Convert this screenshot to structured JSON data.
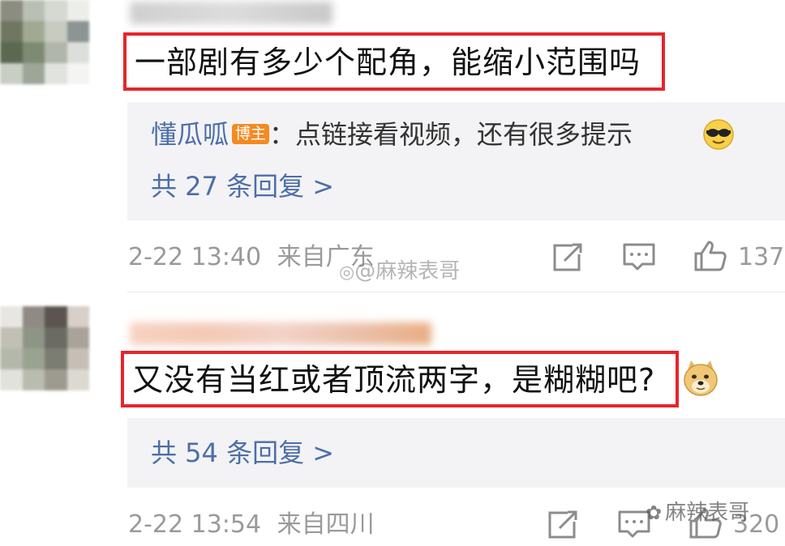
{
  "comments": [
    {
      "text": "一部剧有多少个配角，能缩小范围吗",
      "reply_preview": {
        "author": "懂瓜呱",
        "badge": "博主",
        "separator": "：",
        "text": "点链接看视频，还有很多提示"
      },
      "more_replies": "共 27 条回复 >",
      "timestamp": "2-22 13:40",
      "location": "来自广东",
      "likes": "137"
    },
    {
      "text": "又没有当红或者顶流两字，是糊糊吧?",
      "more_replies": "共 54 条回复 >",
      "timestamp": "2-22 13:54",
      "location": "来自四川",
      "likes": "320"
    }
  ],
  "watermarks": {
    "weibo": "@麻辣表哥",
    "wechat": "麻辣表哥"
  },
  "icons": {
    "share": "share-icon",
    "comment": "comment-icon",
    "like": "thumbs-up-icon"
  },
  "colors": {
    "highlight_box": "#e5262b",
    "link_blue": "#4d6ea8",
    "badge_orange": "#f48a22",
    "meta_gray": "#9a9a9a"
  }
}
